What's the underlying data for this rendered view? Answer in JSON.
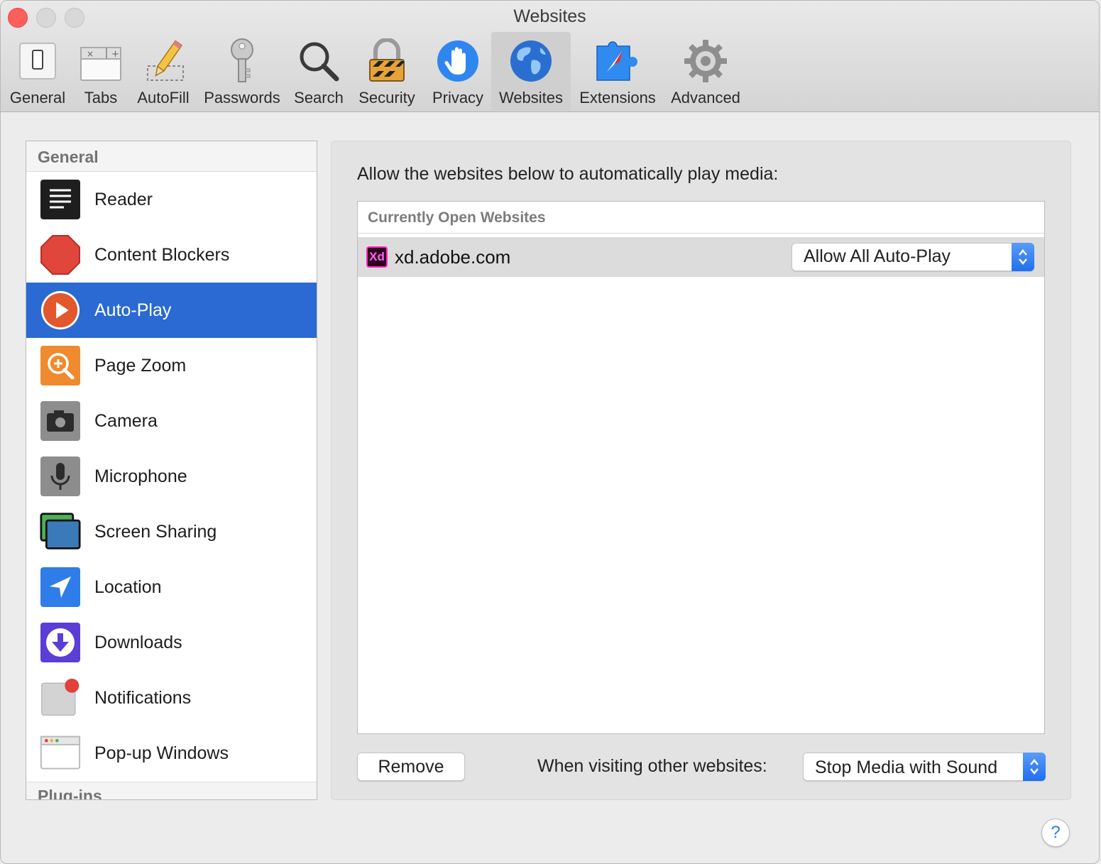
{
  "window": {
    "title": "Websites"
  },
  "toolbar": {
    "items": [
      {
        "label": "General",
        "icon": "general-switch-icon"
      },
      {
        "label": "Tabs",
        "icon": "tabs-icon"
      },
      {
        "label": "AutoFill",
        "icon": "pencil-icon"
      },
      {
        "label": "Passwords",
        "icon": "key-icon"
      },
      {
        "label": "Search",
        "icon": "magnifier-icon"
      },
      {
        "label": "Security",
        "icon": "padlock-icon"
      },
      {
        "label": "Privacy",
        "icon": "hand-icon"
      },
      {
        "label": "Websites",
        "icon": "globe-icon",
        "active": true
      },
      {
        "label": "Extensions",
        "icon": "puzzle-compass-icon"
      },
      {
        "label": "Advanced",
        "icon": "gear-icon"
      }
    ]
  },
  "sidebar": {
    "header": "General",
    "items": [
      {
        "label": "Reader",
        "icon": "reader-icon"
      },
      {
        "label": "Content Blockers",
        "icon": "stop-sign-icon"
      },
      {
        "label": "Auto-Play",
        "icon": "play-icon",
        "selected": true
      },
      {
        "label": "Page Zoom",
        "icon": "zoom-icon"
      },
      {
        "label": "Camera",
        "icon": "camera-icon"
      },
      {
        "label": "Microphone",
        "icon": "microphone-icon"
      },
      {
        "label": "Screen Sharing",
        "icon": "screen-sharing-icon"
      },
      {
        "label": "Location",
        "icon": "location-icon"
      },
      {
        "label": "Downloads",
        "icon": "downloads-icon"
      },
      {
        "label": "Notifications",
        "icon": "notifications-icon"
      },
      {
        "label": "Pop-up Windows",
        "icon": "popup-windows-icon"
      }
    ],
    "footer_partial": "Plug-ins"
  },
  "main": {
    "caption": "Allow the websites below to automatically play media:",
    "table_header": "Currently Open Websites",
    "rows": [
      {
        "badge": "Xd",
        "site": "xd.adobe.com",
        "setting": "Allow All Auto-Play"
      }
    ],
    "remove_button": "Remove",
    "other_label": "When visiting other websites:",
    "other_setting": "Stop Media with Sound"
  },
  "help": {
    "label": "?"
  },
  "colors": {
    "selection": "#2a6ad2",
    "accent": "#1f6ff0",
    "close": "#fc605c"
  }
}
